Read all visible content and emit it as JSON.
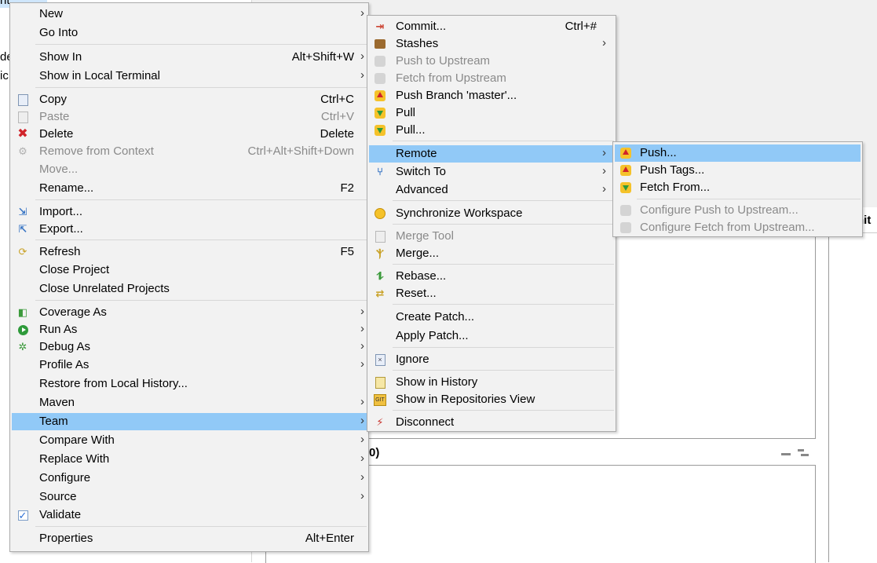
{
  "background": {
    "left_fragments": [
      "nt",
      "de",
      "ic"
    ],
    "pane_title": "0)",
    "right_tab_label": "nit"
  },
  "main_menu": {
    "items": [
      {
        "label": "New",
        "shortcut": "",
        "submenu": true,
        "icon": "",
        "disabled": false
      },
      {
        "label": "Go Into",
        "shortcut": "",
        "submenu": false,
        "icon": "",
        "disabled": false
      },
      {
        "label": "Show In",
        "shortcut": "Alt+Shift+W",
        "submenu": true,
        "icon": "",
        "disabled": false
      },
      {
        "label": "Show in Local Terminal",
        "shortcut": "",
        "submenu": true,
        "icon": "",
        "disabled": false
      },
      {
        "label": "Copy",
        "shortcut": "Ctrl+C",
        "submenu": false,
        "icon": "copy-icon",
        "disabled": false
      },
      {
        "label": "Paste",
        "shortcut": "Ctrl+V",
        "submenu": false,
        "icon": "paste-icon",
        "disabled": true
      },
      {
        "label": "Delete",
        "shortcut": "Delete",
        "submenu": false,
        "icon": "delete-icon",
        "disabled": false
      },
      {
        "label": "Remove from Context",
        "shortcut": "Ctrl+Alt+Shift+Down",
        "submenu": false,
        "icon": "remove-context-icon",
        "disabled": true
      },
      {
        "label": "Move...",
        "shortcut": "",
        "submenu": false,
        "icon": "",
        "disabled": true
      },
      {
        "label": "Rename...",
        "shortcut": "F2",
        "submenu": false,
        "icon": "",
        "disabled": false
      },
      {
        "label": "Import...",
        "shortcut": "",
        "submenu": false,
        "icon": "import-icon",
        "disabled": false
      },
      {
        "label": "Export...",
        "shortcut": "",
        "submenu": false,
        "icon": "export-icon",
        "disabled": false
      },
      {
        "label": "Refresh",
        "shortcut": "F5",
        "submenu": false,
        "icon": "refresh-icon",
        "disabled": false
      },
      {
        "label": "Close Project",
        "shortcut": "",
        "submenu": false,
        "icon": "",
        "disabled": false
      },
      {
        "label": "Close Unrelated Projects",
        "shortcut": "",
        "submenu": false,
        "icon": "",
        "disabled": false
      },
      {
        "label": "Coverage As",
        "shortcut": "",
        "submenu": true,
        "icon": "coverage-icon",
        "disabled": false
      },
      {
        "label": "Run As",
        "shortcut": "",
        "submenu": true,
        "icon": "run-icon",
        "disabled": false
      },
      {
        "label": "Debug As",
        "shortcut": "",
        "submenu": true,
        "icon": "debug-icon",
        "disabled": false
      },
      {
        "label": "Profile As",
        "shortcut": "",
        "submenu": true,
        "icon": "",
        "disabled": false
      },
      {
        "label": "Restore from Local History...",
        "shortcut": "",
        "submenu": false,
        "icon": "",
        "disabled": false
      },
      {
        "label": "Maven",
        "shortcut": "",
        "submenu": true,
        "icon": "",
        "disabled": false
      },
      {
        "label": "Team",
        "shortcut": "",
        "submenu": true,
        "icon": "",
        "disabled": false,
        "selected": true
      },
      {
        "label": "Compare With",
        "shortcut": "",
        "submenu": true,
        "icon": "",
        "disabled": false
      },
      {
        "label": "Replace With",
        "shortcut": "",
        "submenu": true,
        "icon": "",
        "disabled": false
      },
      {
        "label": "Configure",
        "shortcut": "",
        "submenu": true,
        "icon": "",
        "disabled": false
      },
      {
        "label": "Source",
        "shortcut": "",
        "submenu": true,
        "icon": "",
        "disabled": false
      },
      {
        "label": "Validate",
        "shortcut": "",
        "submenu": false,
        "icon": "validate-check-icon",
        "disabled": false
      },
      {
        "label": "Properties",
        "shortcut": "Alt+Enter",
        "submenu": false,
        "icon": "",
        "disabled": false
      }
    ]
  },
  "team_menu": {
    "items": [
      {
        "label": "Commit...",
        "shortcut": "Ctrl+#",
        "submenu": false,
        "icon": "commit-icon",
        "disabled": false
      },
      {
        "label": "Stashes",
        "shortcut": "",
        "submenu": true,
        "icon": "stash-icon",
        "disabled": false
      },
      {
        "label": "Push to Upstream",
        "shortcut": "",
        "submenu": false,
        "icon": "push-upstream-icon",
        "disabled": true
      },
      {
        "label": "Fetch from Upstream",
        "shortcut": "",
        "submenu": false,
        "icon": "fetch-upstream-icon",
        "disabled": true
      },
      {
        "label": "Push Branch 'master'...",
        "shortcut": "",
        "submenu": false,
        "icon": "push-branch-icon",
        "disabled": false
      },
      {
        "label": "Pull",
        "shortcut": "",
        "submenu": false,
        "icon": "pull-icon",
        "disabled": false
      },
      {
        "label": "Pull...",
        "shortcut": "",
        "submenu": false,
        "icon": "pull-dialog-icon",
        "disabled": false
      },
      {
        "label": "Remote",
        "shortcut": "",
        "submenu": true,
        "icon": "",
        "disabled": false,
        "selected": true
      },
      {
        "label": "Switch To",
        "shortcut": "",
        "submenu": true,
        "icon": "switch-branch-icon",
        "disabled": false
      },
      {
        "label": "Advanced",
        "shortcut": "",
        "submenu": true,
        "icon": "",
        "disabled": false
      },
      {
        "label": "Synchronize Workspace",
        "shortcut": "",
        "submenu": false,
        "icon": "synchronize-icon",
        "disabled": false
      },
      {
        "label": "Merge Tool",
        "shortcut": "",
        "submenu": false,
        "icon": "merge-tool-icon",
        "disabled": true
      },
      {
        "label": "Merge...",
        "shortcut": "",
        "submenu": false,
        "icon": "merge-icon",
        "disabled": false
      },
      {
        "label": "Rebase...",
        "shortcut": "",
        "submenu": false,
        "icon": "rebase-icon",
        "disabled": false
      },
      {
        "label": "Reset...",
        "shortcut": "",
        "submenu": false,
        "icon": "reset-icon",
        "disabled": false
      },
      {
        "label": "Create Patch...",
        "shortcut": "",
        "submenu": false,
        "icon": "",
        "disabled": false
      },
      {
        "label": "Apply Patch...",
        "shortcut": "",
        "submenu": false,
        "icon": "",
        "disabled": false
      },
      {
        "label": "Ignore",
        "shortcut": "",
        "submenu": false,
        "icon": "ignore-icon",
        "disabled": false
      },
      {
        "label": "Show in History",
        "shortcut": "",
        "submenu": false,
        "icon": "history-icon",
        "disabled": false
      },
      {
        "label": "Show in Repositories View",
        "shortcut": "",
        "submenu": false,
        "icon": "git-repo-icon",
        "disabled": false
      },
      {
        "label": "Disconnect",
        "shortcut": "",
        "submenu": false,
        "icon": "disconnect-icon",
        "disabled": false
      }
    ]
  },
  "remote_menu": {
    "items": [
      {
        "label": "Push...",
        "icon": "push-icon",
        "disabled": false,
        "selected": true
      },
      {
        "label": "Push Tags...",
        "icon": "push-tags-icon",
        "disabled": false
      },
      {
        "label": "Fetch From...",
        "icon": "fetch-icon",
        "disabled": false
      },
      {
        "label": "Configure Push to Upstream...",
        "icon": "configure-push-icon",
        "disabled": true
      },
      {
        "label": "Configure Fetch from Upstream...",
        "icon": "configure-fetch-icon",
        "disabled": true
      }
    ]
  },
  "colors": {
    "selection": "#91c9f7",
    "menu_background": "#f2f2f2",
    "disabled_text": "#8a8a8a"
  }
}
